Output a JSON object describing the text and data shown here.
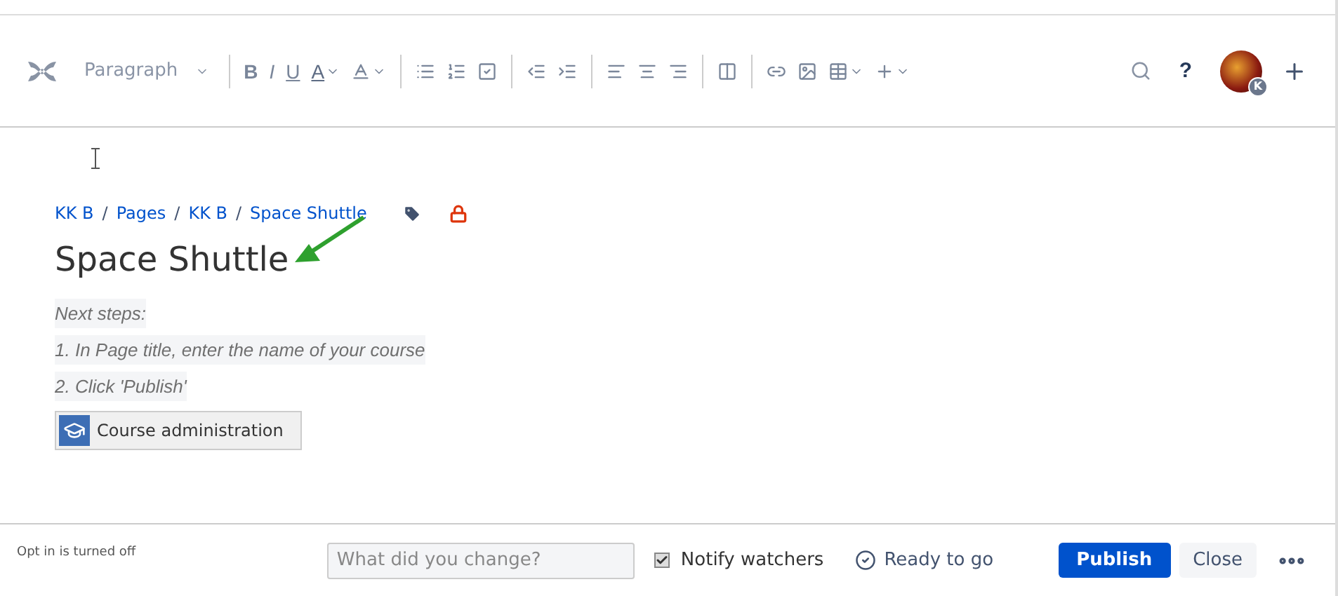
{
  "toolbar": {
    "style_select": {
      "label": "Paragraph"
    },
    "groups": [
      [
        {
          "label": "B",
          "kind": "bold",
          "dropdown": false
        },
        {
          "label": "I",
          "kind": "italic",
          "dropdown": false
        },
        {
          "label": "U",
          "kind": "underline",
          "dropdown": false
        },
        {
          "label": "A",
          "kind": "color",
          "dropdown": true
        },
        {
          "kind": "format",
          "dropdown": true
        }
      ],
      [
        {
          "kind": "bullets",
          "dropdown": false
        },
        {
          "kind": "numbers",
          "dropdown": false
        },
        {
          "kind": "task",
          "dropdown": false
        }
      ],
      [
        {
          "kind": "outdent",
          "dropdown": false
        },
        {
          "kind": "indent",
          "dropdown": false
        }
      ],
      [
        {
          "kind": "left",
          "dropdown": false
        },
        {
          "kind": "center",
          "dropdown": false
        },
        {
          "kind": "right",
          "dropdown": false
        }
      ],
      [
        {
          "kind": "layout",
          "dropdown": false
        }
      ],
      [
        {
          "kind": "link",
          "dropdown": false
        },
        {
          "kind": "image",
          "dropdown": false
        },
        {
          "kind": "table",
          "dropdown": true
        },
        {
          "kind": "insert",
          "dropdown": true
        }
      ]
    ],
    "help": "?",
    "avatar_badge": "K"
  },
  "breadcrumbs": [
    {
      "kind": "link",
      "text": "KK B"
    },
    {
      "kind": "separator",
      "text": "/"
    },
    {
      "kind": "link",
      "text": "Pages"
    },
    {
      "kind": "separator",
      "text": "/"
    },
    {
      "kind": "link",
      "text": "KK B"
    },
    {
      "kind": "separator",
      "text": "/"
    },
    {
      "kind": "link",
      "text": "Space Shuttle"
    }
  ],
  "page_title": "Space Shuttle",
  "instructions": [
    "Next steps:",
    "1. In Page title, enter the name of your course",
    "2. Click 'Publish'"
  ],
  "macro_button": {
    "label": "Course administration"
  },
  "footer": {
    "opt_in": "Opt in is turned off",
    "comment": {
      "placeholder": "What did you change?"
    },
    "notify": {
      "label": "Notify watchers",
      "checked": true
    },
    "status": "Ready to go",
    "publish": "Publish",
    "close": "Close"
  }
}
